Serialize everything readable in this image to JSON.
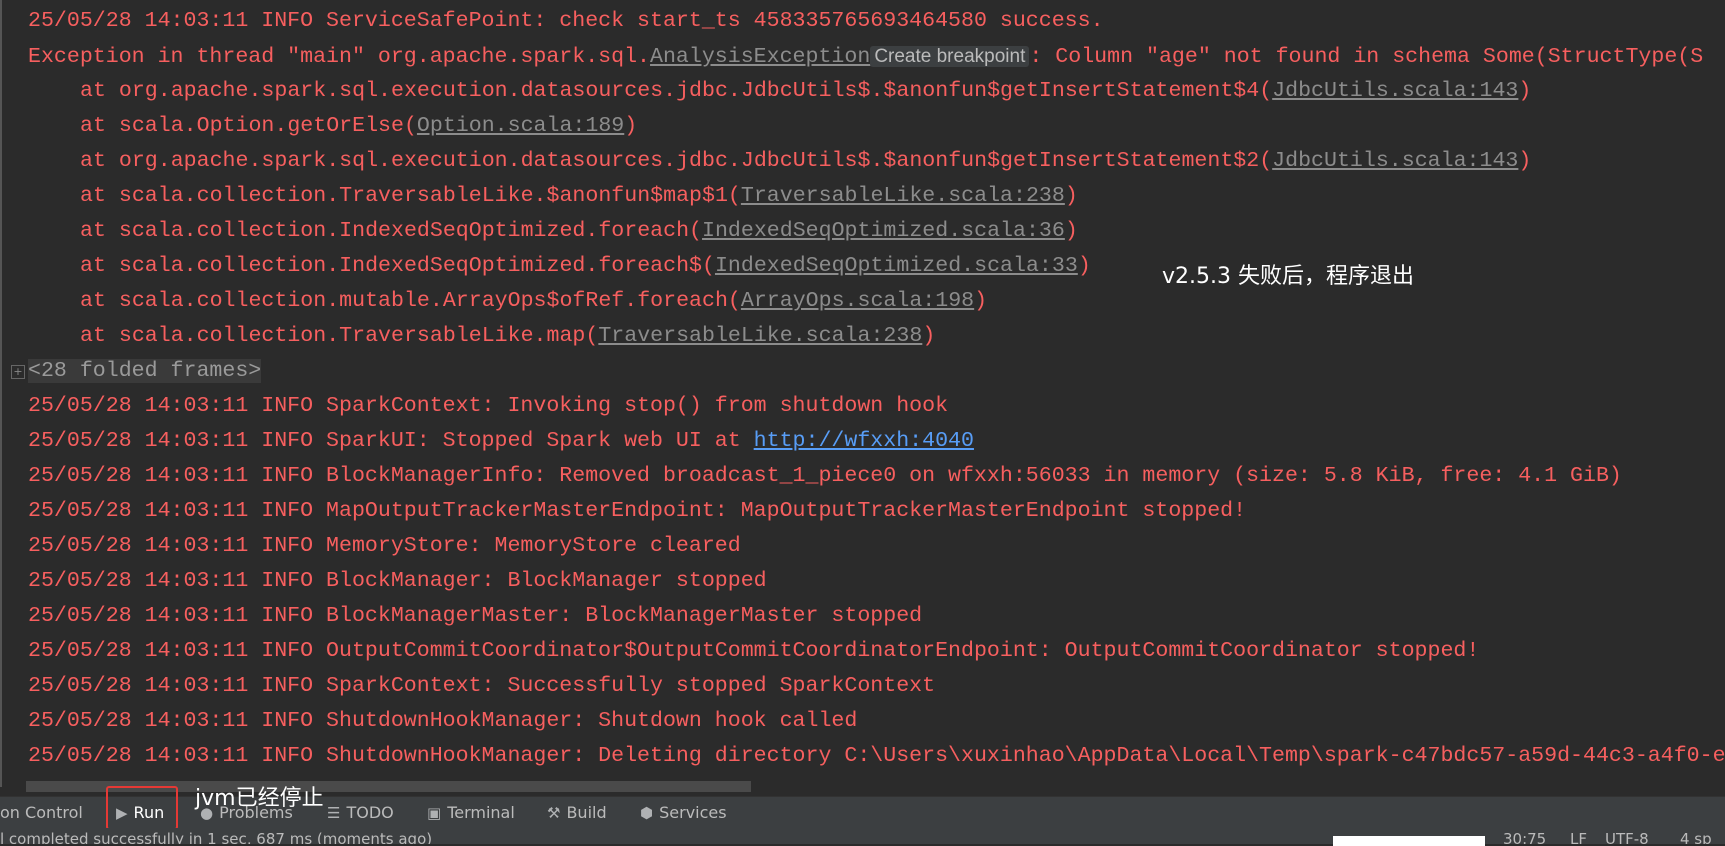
{
  "console": {
    "lines": [
      {
        "indent": false,
        "segments": [
          {
            "t": "text",
            "v": "25/05/28 14:03:11 INFO ServiceSafePoint: check start_ts 458335765693464580 success."
          }
        ]
      },
      {
        "indent": false,
        "segments": [
          {
            "t": "text",
            "v": "Exception in thread \"main\" org.apache.spark.sql."
          },
          {
            "t": "lnk",
            "v": "AnalysisException"
          },
          {
            "t": "bp",
            "v": "Create breakpoint"
          },
          {
            "t": "text",
            "v": ": Column \"age\" not found in schema Some(StructType(S"
          }
        ]
      },
      {
        "indent": true,
        "segments": [
          {
            "t": "text",
            "v": "at org.apache.spark.sql.execution.datasources.jdbc.JdbcUtils$.$anonfun$getInsertStatement$4("
          },
          {
            "t": "lnk",
            "v": "JdbcUtils.scala:143"
          },
          {
            "t": "text",
            "v": ")"
          }
        ]
      },
      {
        "indent": true,
        "segments": [
          {
            "t": "text",
            "v": "at scala.Option.getOrElse("
          },
          {
            "t": "lnk",
            "v": "Option.scala:189"
          },
          {
            "t": "text",
            "v": ")"
          }
        ]
      },
      {
        "indent": true,
        "segments": [
          {
            "t": "text",
            "v": "at org.apache.spark.sql.execution.datasources.jdbc.JdbcUtils$.$anonfun$getInsertStatement$2("
          },
          {
            "t": "lnk",
            "v": "JdbcUtils.scala:143"
          },
          {
            "t": "text",
            "v": ")"
          }
        ]
      },
      {
        "indent": true,
        "segments": [
          {
            "t": "text",
            "v": "at scala.collection.TraversableLike.$anonfun$map$1("
          },
          {
            "t": "lnk",
            "v": "TraversableLike.scala:238"
          },
          {
            "t": "text",
            "v": ")"
          }
        ]
      },
      {
        "indent": true,
        "segments": [
          {
            "t": "text",
            "v": "at scala.collection.IndexedSeqOptimized.foreach("
          },
          {
            "t": "lnk",
            "v": "IndexedSeqOptimized.scala:36"
          },
          {
            "t": "text",
            "v": ")"
          }
        ]
      },
      {
        "indent": true,
        "segments": [
          {
            "t": "text",
            "v": "at scala.collection.IndexedSeqOptimized.foreach$("
          },
          {
            "t": "lnk",
            "v": "IndexedSeqOptimized.scala:33"
          },
          {
            "t": "text",
            "v": ")"
          }
        ]
      },
      {
        "indent": true,
        "segments": [
          {
            "t": "text",
            "v": "at scala.collection.mutable.ArrayOps$ofRef.foreach("
          },
          {
            "t": "lnk",
            "v": "ArrayOps.scala:198"
          },
          {
            "t": "text",
            "v": ")"
          }
        ]
      },
      {
        "indent": true,
        "segments": [
          {
            "t": "text",
            "v": "at scala.collection.TraversableLike.map("
          },
          {
            "t": "lnk",
            "v": "TraversableLike.scala:238"
          },
          {
            "t": "text",
            "v": ")"
          }
        ]
      },
      {
        "indent": false,
        "fold": true,
        "segments": [
          {
            "t": "fold",
            "v": "<28 folded frames>"
          }
        ]
      },
      {
        "indent": false,
        "segments": [
          {
            "t": "text",
            "v": "25/05/28 14:03:11 INFO SparkContext: Invoking stop() from shutdown hook"
          }
        ]
      },
      {
        "indent": false,
        "segments": [
          {
            "t": "text",
            "v": "25/05/28 14:03:11 INFO SparkUI: Stopped Spark web UI at "
          },
          {
            "t": "url",
            "v": "http://wfxxh:4040"
          }
        ]
      },
      {
        "indent": false,
        "segments": [
          {
            "t": "text",
            "v": "25/05/28 14:03:11 INFO BlockManagerInfo: Removed broadcast_1_piece0 on wfxxh:56033 in memory (size: 5.8 KiB, free: 4.1 GiB)"
          }
        ]
      },
      {
        "indent": false,
        "segments": [
          {
            "t": "text",
            "v": "25/05/28 14:03:11 INFO MapOutputTrackerMasterEndpoint: MapOutputTrackerMasterEndpoint stopped!"
          }
        ]
      },
      {
        "indent": false,
        "segments": [
          {
            "t": "text",
            "v": "25/05/28 14:03:11 INFO MemoryStore: MemoryStore cleared"
          }
        ]
      },
      {
        "indent": false,
        "segments": [
          {
            "t": "text",
            "v": "25/05/28 14:03:11 INFO BlockManager: BlockManager stopped"
          }
        ]
      },
      {
        "indent": false,
        "segments": [
          {
            "t": "text",
            "v": "25/05/28 14:03:11 INFO BlockManagerMaster: BlockManagerMaster stopped"
          }
        ]
      },
      {
        "indent": false,
        "segments": [
          {
            "t": "text",
            "v": "25/05/28 14:03:11 INFO OutputCommitCoordinator$OutputCommitCoordinatorEndpoint: OutputCommitCoordinator stopped!"
          }
        ]
      },
      {
        "indent": false,
        "segments": [
          {
            "t": "text",
            "v": "25/05/28 14:03:11 INFO SparkContext: Successfully stopped SparkContext"
          }
        ]
      },
      {
        "indent": false,
        "segments": [
          {
            "t": "text",
            "v": "25/05/28 14:03:11 INFO ShutdownHookManager: Shutdown hook called"
          }
        ]
      },
      {
        "indent": false,
        "segments": [
          {
            "t": "text",
            "v": "25/05/28 14:03:11 INFO ShutdownHookManager: Deleting directory C:\\Users\\xuxinhao\\AppData\\Local\\Temp\\spark-c47bdc57-a59d-44c3-a4f0-e"
          }
        ]
      }
    ]
  },
  "annotations": {
    "note": "v2.5.3 失败后，程序退出",
    "jvm": "jvm已经停止"
  },
  "toolbar": {
    "items": [
      {
        "label": "on Control",
        "icon": ""
      },
      {
        "label": "Run",
        "icon": "▶"
      },
      {
        "label": "Problems",
        "icon": "●"
      },
      {
        "label": "TODO",
        "icon": "☰"
      },
      {
        "label": "Terminal",
        "icon": "▣"
      },
      {
        "label": "Build",
        "icon": "⚒"
      },
      {
        "label": "Services",
        "icon": "⬢"
      }
    ]
  },
  "status": {
    "message": "l completed successfully in 1 sec, 687 ms (moments ago)",
    "position": "30:75",
    "line_sep": "LF",
    "encoding": "UTF-8",
    "indent": "4 sp"
  }
}
